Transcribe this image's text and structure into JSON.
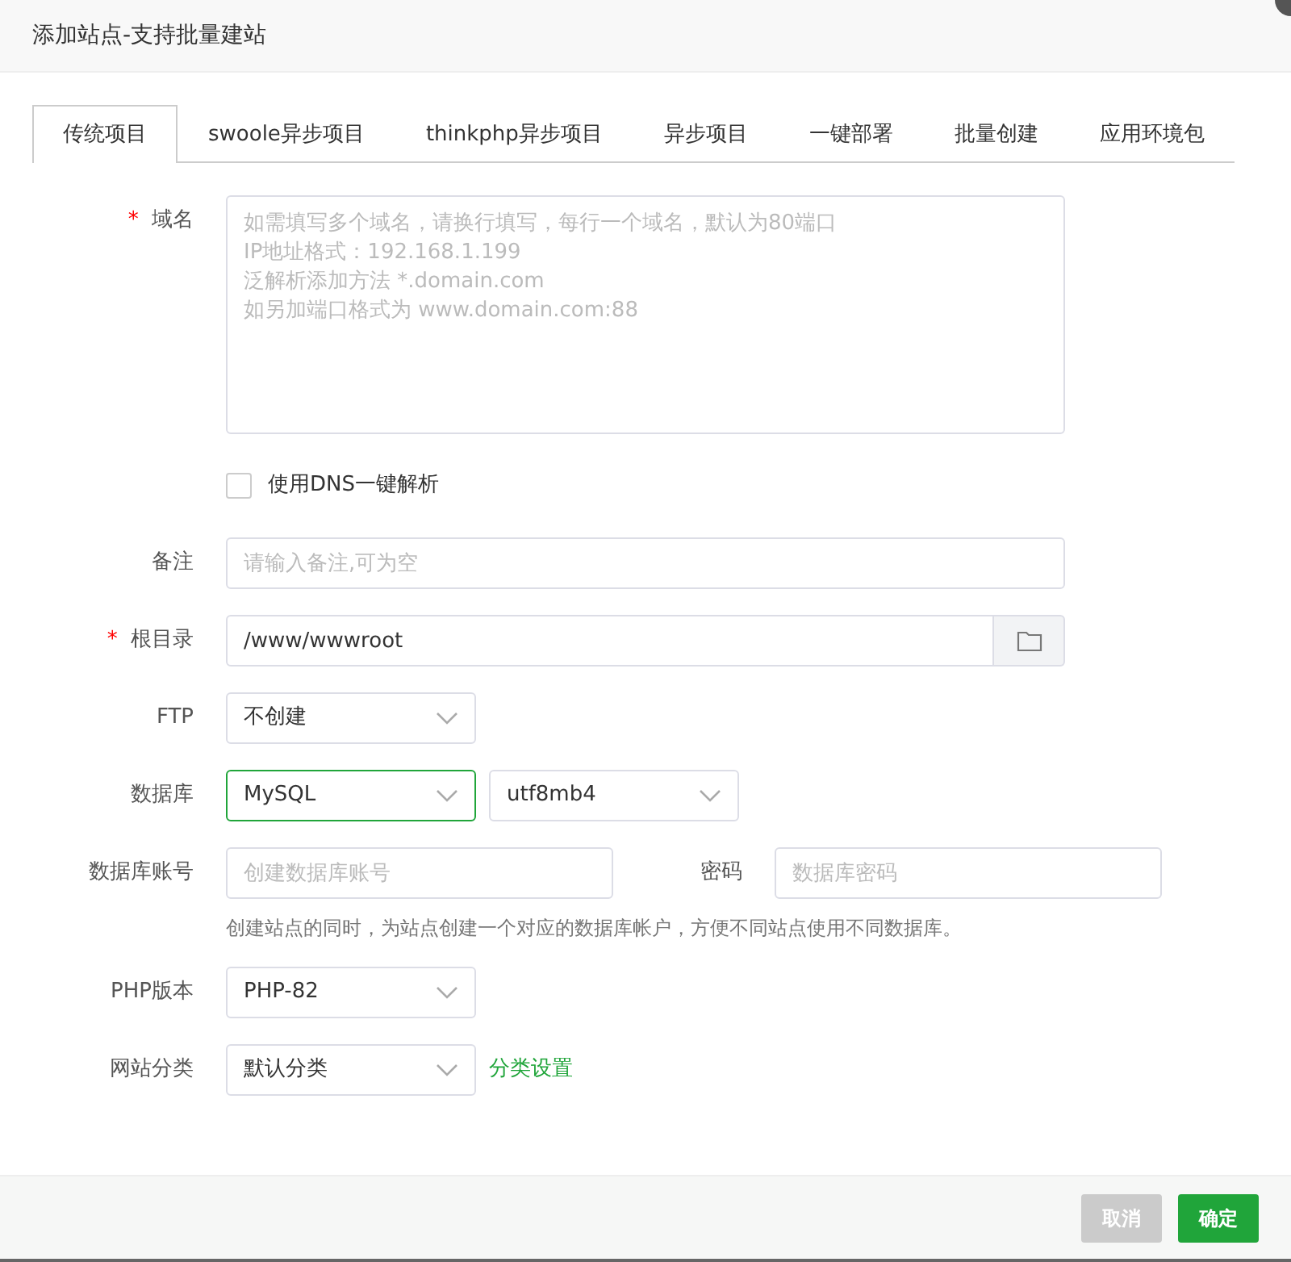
{
  "window": {
    "title": "添加站点-支持批量建站"
  },
  "tabs": [
    {
      "label": "传统项目",
      "selected": true
    },
    {
      "label": "swoole异步项目",
      "selected": false
    },
    {
      "label": "thinkphp异步项目",
      "selected": false
    },
    {
      "label": "异步项目",
      "selected": false
    },
    {
      "label": "一键部署",
      "selected": false
    },
    {
      "label": "批量创建",
      "selected": false
    },
    {
      "label": "应用环境包",
      "selected": false
    }
  ],
  "rows": [
    {
      "kind": "textarea",
      "label": "域名",
      "marker": "*",
      "placeholder": "如需填写多个域名，请换行填写，每行一个域名，默认为80端口\nIP地址格式：192.168.1.199\n泛解析添加方法 *.domain.com\n如另加端口格式为 www.domain.com:88"
    },
    {
      "kind": "checkbox",
      "text": "使用DNS一键解析",
      "checked": false
    },
    {
      "kind": "input",
      "label": "备注",
      "placeholder": "请输入备注,可为空"
    },
    {
      "kind": "path",
      "label": "根目录",
      "marker": "*",
      "value": "/www/wwwroot"
    },
    {
      "kind": "select",
      "label": "FTP",
      "selects": [
        {
          "value": "不创建",
          "focused": false
        }
      ]
    },
    {
      "kind": "select",
      "label": "数据库",
      "selects": [
        {
          "value": "MySQL",
          "focused": true
        },
        {
          "value": "utf8mb4",
          "focused": false
        }
      ]
    },
    {
      "kind": "credentials",
      "label": "数据库账号",
      "placeholder": "创建数据库账号",
      "label_2": "密码",
      "placeholder_2": "数据库密码"
    },
    {
      "kind": "hint",
      "text": "创建站点的同时，为站点创建一个对应的数据库帐户，方便不同站点使用不同数据库。"
    },
    {
      "kind": "select",
      "label": "PHP版本",
      "selects": [
        {
          "value": "PHP-82",
          "focused": false
        }
      ]
    },
    {
      "kind": "select",
      "label": "网站分类",
      "selects": [
        {
          "value": "默认分类",
          "focused": false
        }
      ],
      "link": "分类设置"
    }
  ],
  "buttons": [
    {
      "label": "取消",
      "kind": "cancel",
      "disabled": true
    },
    {
      "label": "确定",
      "kind": "confirm",
      "disabled": false
    }
  ]
}
